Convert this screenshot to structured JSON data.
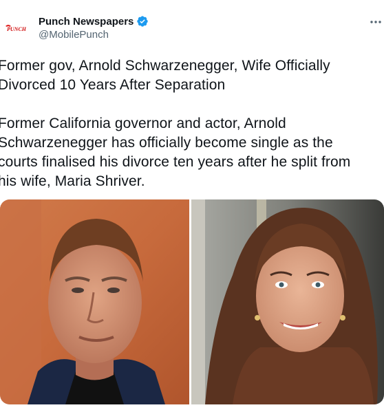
{
  "account": {
    "display_name": "Punch Newspapers",
    "handle": "@MobilePunch",
    "avatar_text": "PUNCH",
    "verified_icon": "verified-badge-icon",
    "verified_color": "#1d9bf0"
  },
  "menu": {
    "icon": "more-options-icon"
  },
  "tweet": {
    "headline": "Former gov, Arnold Schwarzenegger, Wife Officially\nDivorced 10 Years After Separation",
    "body": "Former California governor and actor, Arnold\nSchwarzenegger has officially become single as the\ncourts finalised his divorce ten years after he split from\nhis wife, Maria Shriver."
  },
  "media": {
    "photos": [
      {
        "name": "arnold-schwarzenegger-photo"
      },
      {
        "name": "maria-shriver-photo"
      }
    ]
  }
}
